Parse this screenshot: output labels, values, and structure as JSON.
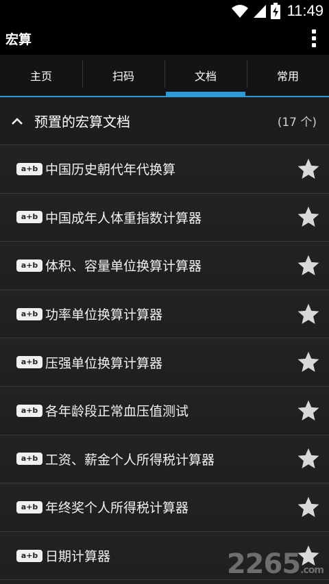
{
  "status_bar": {
    "time": "11:49",
    "icons": [
      "wifi-icon",
      "signal-icon",
      "battery-icon"
    ]
  },
  "action_bar": {
    "title": "宏算",
    "menu_icon": "overflow-menu-icon"
  },
  "tabs": [
    {
      "label": "主页",
      "active": false
    },
    {
      "label": "扫码",
      "active": false
    },
    {
      "label": "文档",
      "active": true
    },
    {
      "label": "常用",
      "active": false
    }
  ],
  "section": {
    "title": "预置的宏算文档",
    "count": "(17 个)",
    "icon": "chevron-up-icon"
  },
  "badge_text": "a+b",
  "items": [
    {
      "label": "中国历史朝代年代换算"
    },
    {
      "label": "中国成年人体重指数计算器"
    },
    {
      "label": "体积、容量单位换算计算器"
    },
    {
      "label": "功率单位换算计算器"
    },
    {
      "label": "压强单位换算计算器"
    },
    {
      "label": "各年龄段正常血压值测试"
    },
    {
      "label": "工资、薪金个人所得税计算器"
    },
    {
      "label": "年终奖个人所得税计算器"
    },
    {
      "label": "日期计算器"
    }
  ],
  "colors": {
    "accent": "#2f9bd6",
    "background": "#1f2021",
    "star": "#d8d8d8"
  },
  "watermark": {
    "text": "2265",
    "suffix": ".com"
  }
}
